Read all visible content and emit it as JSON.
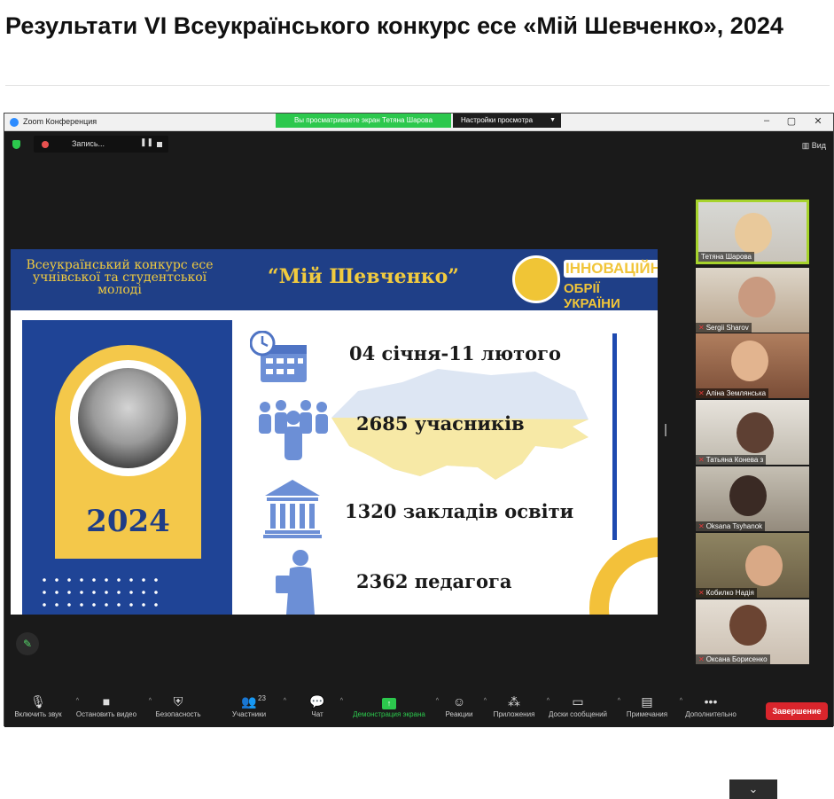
{
  "article": {
    "title": "Результати VI Всеукраїнського конкурс есе «Мій Шевченко», 2024"
  },
  "zoom": {
    "window_title": "Zoom Конференция",
    "viewing_banner": "Вы просматриваете экран Тетяна Шарова",
    "view_options": "Настройки просмотра",
    "recording_label": "Запись...",
    "view_label": "Вид",
    "window_controls": [
      "‒",
      "▢",
      "✕"
    ]
  },
  "slide": {
    "header_left": "Всеукраїнський конкурс есе учнівської та студентської молоді",
    "header_title": "“Мій Шевченко”",
    "logo_line1": "ІННОВАЦІЙНІ",
    "logo_line2": "ОБРІЇ УКРАЇНИ",
    "year": "2024",
    "stats": [
      {
        "text": "04 січня-11 лютого",
        "icon": "calendar-icon"
      },
      {
        "text": "2685 учасників",
        "icon": "people-icon"
      },
      {
        "text": "1320 закладів освіти",
        "icon": "institution-icon"
      },
      {
        "text": "2362 педагога",
        "icon": "teacher-icon"
      }
    ],
    "colors": {
      "blue": "#1f4496",
      "yellow": "#f4c84a",
      "icon_blue": "#6c8fd6"
    }
  },
  "participants": [
    {
      "name": "Тетяна Шарова",
      "muted": false,
      "active": true
    },
    {
      "name": "Sergii Sharov",
      "muted": true,
      "active": false
    },
    {
      "name": "Аліна Землянська",
      "muted": true,
      "active": false
    },
    {
      "name": "Татьяна Конева з",
      "muted": true,
      "active": false
    },
    {
      "name": "Oksana Tsyhanok",
      "muted": true,
      "active": false
    },
    {
      "name": "Кобилко Надія",
      "muted": true,
      "active": false
    },
    {
      "name": "Оксана Борисенко",
      "muted": true,
      "active": false
    }
  ],
  "toolbar": {
    "unmute": "Включить звук",
    "video": "Остановить видео",
    "security": "Безопасность",
    "participants": "Участники",
    "participants_count": "23",
    "chat": "Чат",
    "share": "Демонстрация экрана",
    "reactions": "Реакции",
    "apps": "Приложения",
    "whiteboards": "Доски сообщений",
    "notes": "Примечания",
    "more": "Дополнительно",
    "end": "Завершение"
  }
}
